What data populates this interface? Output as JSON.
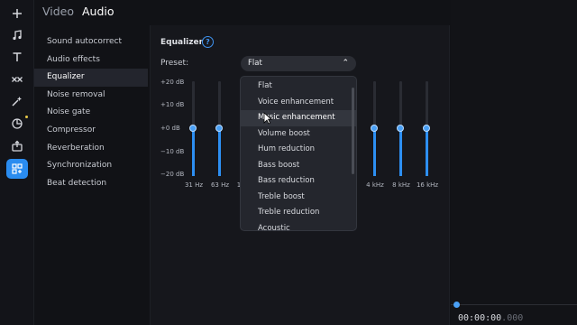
{
  "tabs": [
    {
      "label": "Video",
      "active": false
    },
    {
      "label": "Audio",
      "active": true
    }
  ],
  "rail_icons": [
    "plus-icon",
    "music-note-icon",
    "text-icon",
    "transitions-icon",
    "magic-wand-icon",
    "stickers-icon",
    "export-icon",
    "audio-settings-icon"
  ],
  "settings_list": [
    {
      "label": "Sound autocorrect"
    },
    {
      "label": "Audio effects"
    },
    {
      "label": "Equalizer",
      "active": true
    },
    {
      "label": "Noise removal"
    },
    {
      "label": "Noise gate"
    },
    {
      "label": "Compressor"
    },
    {
      "label": "Reverberation"
    },
    {
      "label": "Synchronization"
    },
    {
      "label": "Beat detection"
    }
  ],
  "equalizer": {
    "title": "Equalizer",
    "help": "?",
    "preset_label": "Preset:",
    "preset_value": "Flat",
    "db_scale": [
      "+20 dB",
      "+10 dB",
      "+0 dB",
      "−10 dB",
      "−20 dB"
    ],
    "bands": [
      {
        "freq": "31 Hz",
        "gain_db": 0
      },
      {
        "freq": "63 Hz",
        "gain_db": 0
      },
      {
        "freq": "1",
        "gain_db": 0
      },
      {
        "freq": "4 kHz",
        "gain_db": 0
      },
      {
        "freq": "8 kHz",
        "gain_db": 0
      },
      {
        "freq": "16 kHz",
        "gain_db": 0
      }
    ]
  },
  "preset_options": [
    "Flat",
    "Voice enhancement",
    "Music enhancement",
    "Volume boost",
    "Hum reduction",
    "Bass boost",
    "Bass reduction",
    "Treble boost",
    "Treble reduction",
    "Acoustic"
  ],
  "hovered_option": "Music enhancement",
  "timeline": {
    "time": "00:00:00",
    "time_frac": ".000"
  },
  "colors": {
    "accent": "#2d8ff2",
    "panel": "#16171c",
    "background": "#111216"
  }
}
